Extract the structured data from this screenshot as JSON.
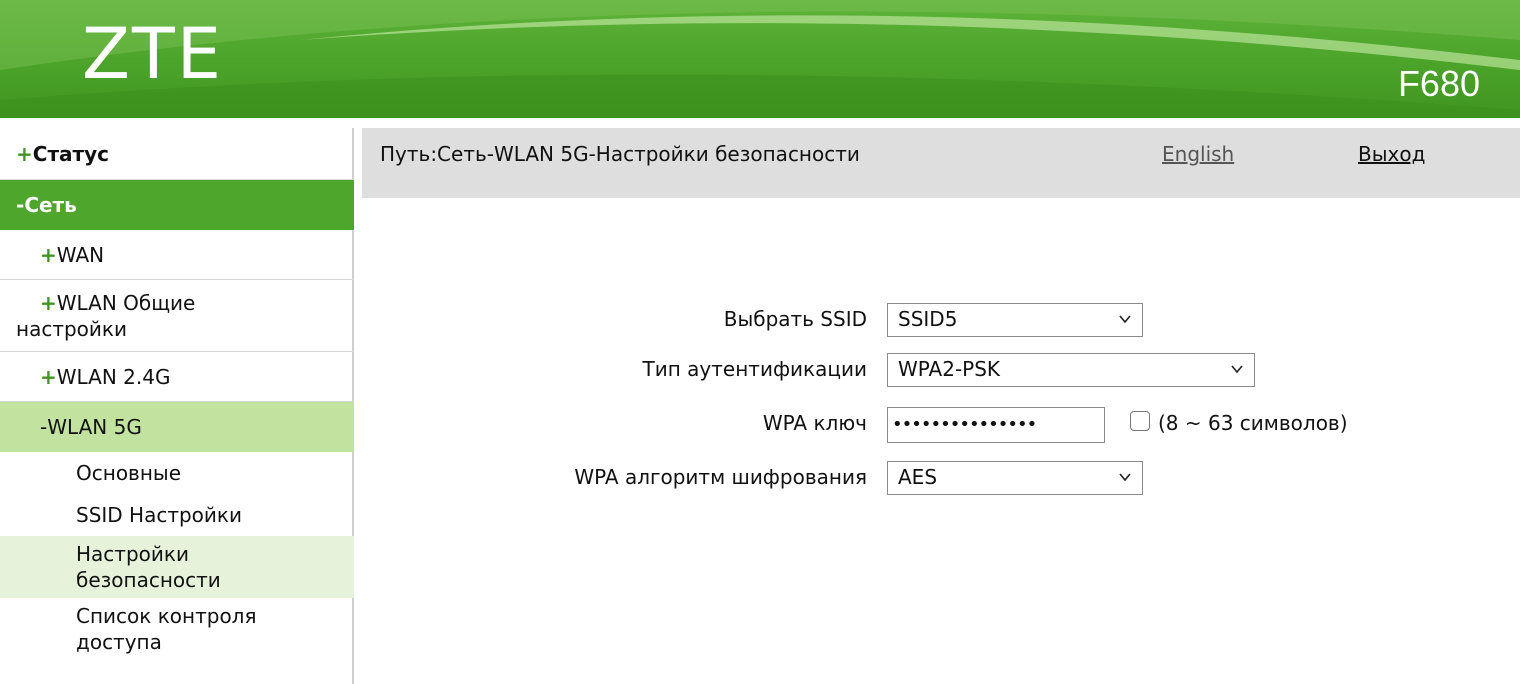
{
  "header": {
    "logo": "ZTE",
    "model": "F680",
    "colors": {
      "green": "#4fa62c",
      "light_green": "#c2e3a0",
      "pale_green": "#e6f3da"
    }
  },
  "sidebar": {
    "items": [
      {
        "prefix": "+",
        "label": "Статус"
      },
      {
        "prefix": "-",
        "label": "Сеть"
      },
      {
        "prefix": "+",
        "label": "WAN"
      },
      {
        "prefix": "+",
        "label": "WLAN Общие настройки"
      },
      {
        "prefix": "+",
        "label": "WLAN 2.4G"
      },
      {
        "prefix": "-",
        "label": "WLAN 5G"
      },
      {
        "label": "Основные"
      },
      {
        "label": "SSID Настройки"
      },
      {
        "label": "Настройки безопасности"
      },
      {
        "label": "Список контроля доступа"
      }
    ]
  },
  "pathbar": {
    "path": "Путь:Сеть-WLAN 5G-Настройки безопасности",
    "language": "English",
    "logout": "Выход"
  },
  "form": {
    "ssid": {
      "label": "Выбрать SSID",
      "value": "SSID5"
    },
    "auth": {
      "label": "Тип аутентификации",
      "value": "WPA2-PSK"
    },
    "key": {
      "label": "WPA ключ",
      "value": "•••••••••••••••",
      "hint": "(8 ~ 63 символов)"
    },
    "cipher": {
      "label": "WPA алгоритм шифрования",
      "value": "AES"
    }
  },
  "icons": [
    "chevron-down-icon",
    "checkbox-icon"
  ]
}
